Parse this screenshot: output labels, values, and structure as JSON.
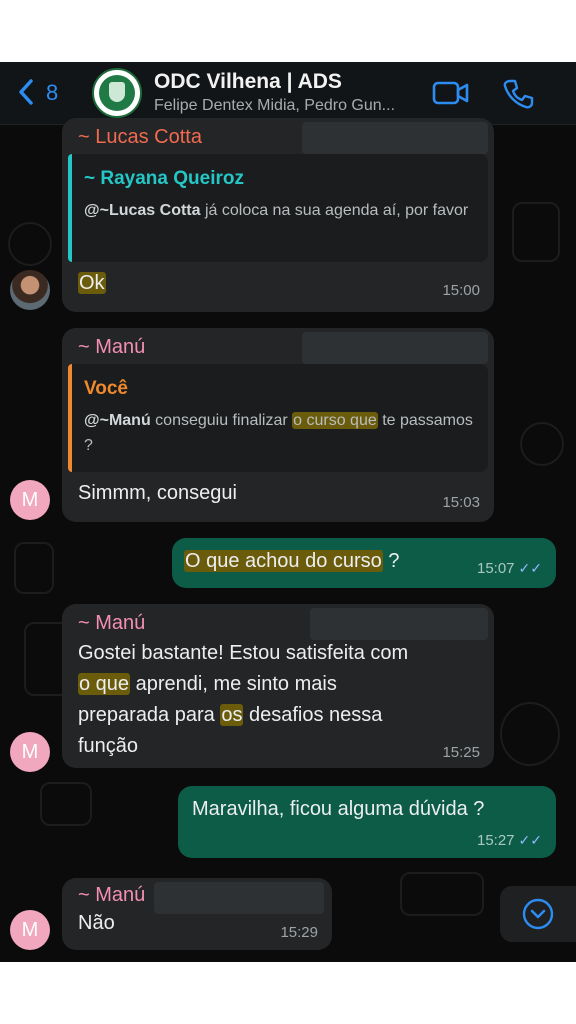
{
  "header": {
    "back_count": "8",
    "title": "ODC Vilhena | ADS",
    "subtitle": "Felipe Dentex Midia, Pedro Gun...",
    "icons": [
      "chevron-left-icon",
      "video-call-icon",
      "phone-icon"
    ]
  },
  "messages": [
    {
      "sender": "~ Lucas Cotta",
      "sender_color": "#f26a4f",
      "quote_author": "~ Rayana Queiroz",
      "quote_color": "#25c6c6",
      "quote_mention": "@~Lucas Cotta",
      "quote_text": " já coloca na sua agenda aí, por favor",
      "text": "Ok",
      "time": "15:00"
    },
    {
      "sender": "~ Manú",
      "sender_color": "#f48fb1",
      "quote_author": "Você",
      "quote_color": "#f0892b",
      "quote_mention": "@~Manú",
      "quote_text_before": " conseguiu finalizar ",
      "quote_text_hl": "o curso que",
      "quote_text_after": " te passamos ?",
      "text": "Simmm, consegui",
      "time": "15:03"
    },
    {
      "outgoing": true,
      "text_hl": "O que achou do curso",
      "text_after": " ?",
      "time": "15:07"
    },
    {
      "sender": "~ Manú",
      "line1": "Gostei bastante! Estou satisfeita com",
      "line2_hl": "o que",
      "line2_after": " aprendi, me sinto mais",
      "line3_before": "preparada para ",
      "line3_hl": "os",
      "line3_after": " desafios nessa",
      "line4": "função",
      "time": "15:25"
    },
    {
      "outgoing": true,
      "text": "Maravilha, ficou alguma dúvida ?",
      "time": "15:27"
    },
    {
      "sender": "~ Manú",
      "text": "Não",
      "time": "15:29"
    }
  ],
  "avatar_letter": "M",
  "colors": {
    "accent": "#2d8cf0",
    "outgoing_bubble": "#0c5c48",
    "incoming_bubble": "#232527",
    "highlight": "#6b5c0c"
  }
}
